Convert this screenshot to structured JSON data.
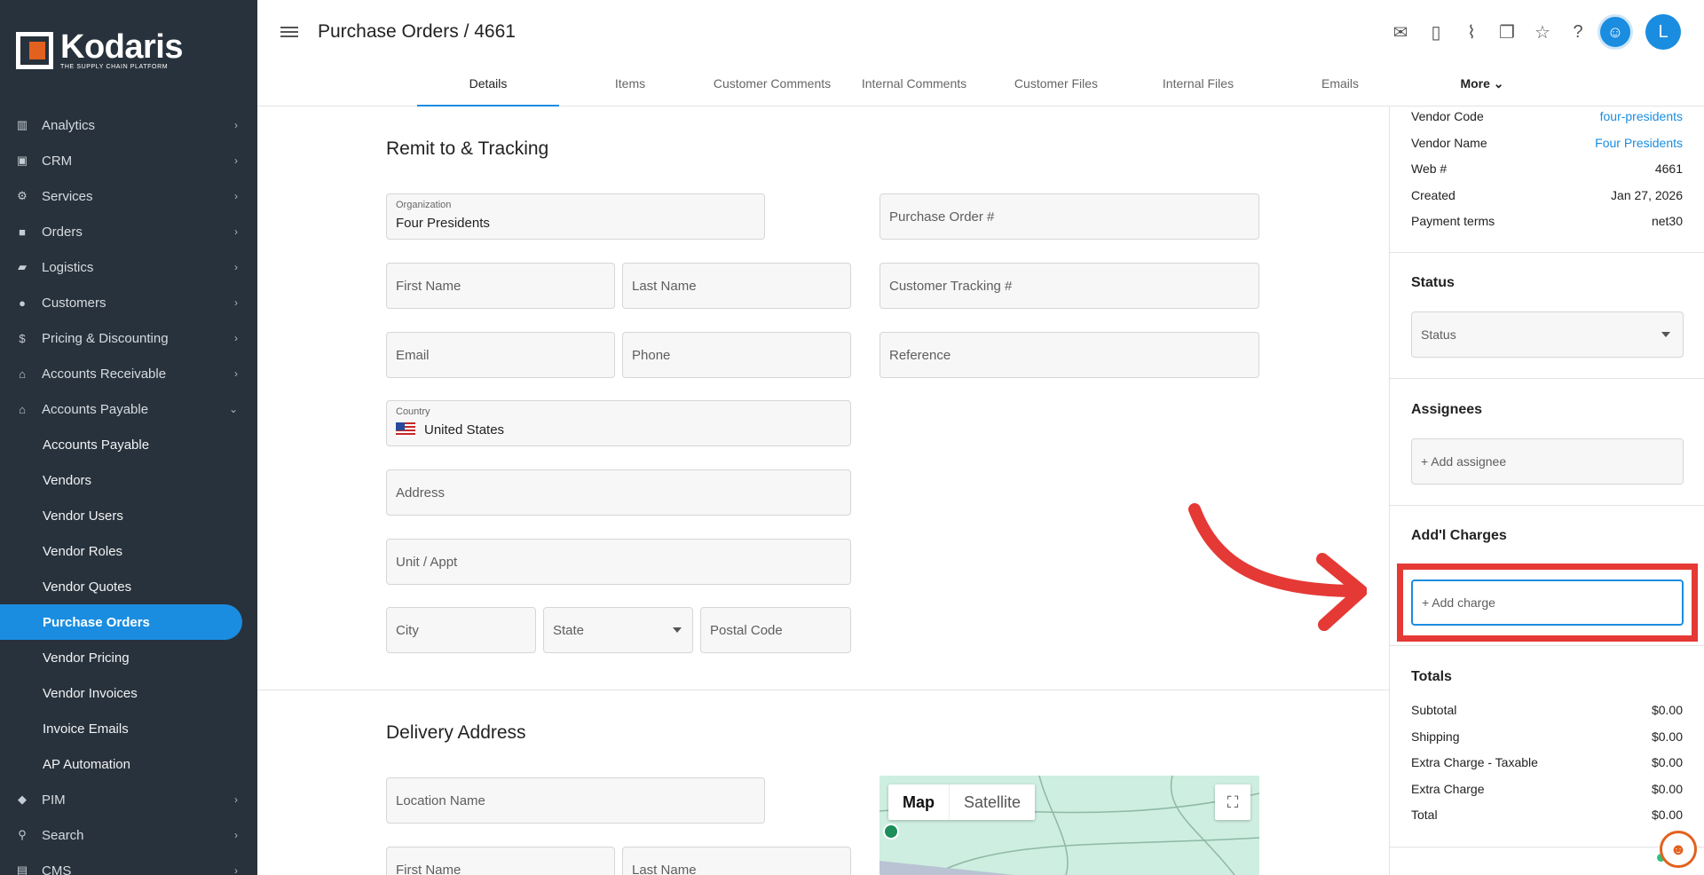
{
  "app": {
    "brand_name": "Kodaris",
    "brand_tagline": "THE SUPPLY CHAIN PLATFORM",
    "accent_color": "#1a8de0",
    "sidebar_color": "#28323c",
    "highlight_color": "#e53935"
  },
  "sidebar": {
    "items": [
      {
        "label": "Analytics",
        "icon": "chart-icon"
      },
      {
        "label": "CRM",
        "icon": "contact-card-icon"
      },
      {
        "label": "Services",
        "icon": "gears-icon"
      },
      {
        "label": "Orders",
        "icon": "truck-icon"
      },
      {
        "label": "Logistics",
        "icon": "delivery-truck-icon"
      },
      {
        "label": "Customers",
        "icon": "people-icon"
      },
      {
        "label": "Pricing & Discounting",
        "icon": "dollar-icon"
      },
      {
        "label": "Accounts Receivable",
        "icon": "bank-icon"
      },
      {
        "label": "Accounts Payable",
        "icon": "bank-icon"
      }
    ],
    "sub_items": [
      "Accounts Payable",
      "Vendors",
      "Vendor Users",
      "Vendor Roles",
      "Vendor Quotes",
      "Purchase Orders",
      "Vendor Pricing",
      "Vendor Invoices",
      "Invoice Emails",
      "AP Automation"
    ],
    "active_sub_item": "Purchase Orders",
    "bottom_items": [
      {
        "label": "PIM",
        "icon": "tag-icon"
      },
      {
        "label": "Search",
        "icon": "search-icon"
      },
      {
        "label": "CMS",
        "icon": "cms-icon"
      }
    ]
  },
  "header": {
    "title": "Purchase Orders / 4661",
    "avatar_initial": "L",
    "tabs": [
      "Details",
      "Items",
      "Customer Comments",
      "Internal Comments",
      "Customer Files",
      "Internal Files",
      "Emails"
    ],
    "active_tab": "Details",
    "more_label": "More"
  },
  "remit": {
    "title": "Remit to & Tracking",
    "organization_label": "Organization",
    "organization_value": "Four Presidents",
    "purchase_order_placeholder": "Purchase Order #",
    "first_name_placeholder": "First Name",
    "last_name_placeholder": "Last Name",
    "customer_tracking_placeholder": "Customer Tracking #",
    "email_placeholder": "Email",
    "phone_placeholder": "Phone",
    "reference_placeholder": "Reference",
    "country_label": "Country",
    "country_value": "United States",
    "address_placeholder": "Address",
    "unit_placeholder": "Unit / Appt",
    "city_placeholder": "City",
    "state_placeholder": "State",
    "postal_placeholder": "Postal Code"
  },
  "delivery": {
    "title": "Delivery Address",
    "location_placeholder": "Location Name",
    "first_name_placeholder": "First Name",
    "last_name_placeholder": "Last Name",
    "map_label": "Map",
    "satellite_label": "Satellite"
  },
  "info": {
    "rows": [
      {
        "key": "Vendor Code",
        "value": "four-presidents",
        "link": true
      },
      {
        "key": "Vendor Name",
        "value": "Four Presidents",
        "link": true
      },
      {
        "key": "Web #",
        "value": "4661",
        "link": false
      },
      {
        "key": "Created",
        "value": "Jan 27, 2026",
        "link": false
      },
      {
        "key": "Payment terms",
        "value": "net30",
        "link": false
      }
    ]
  },
  "status": {
    "title": "Status",
    "placeholder": "Status"
  },
  "assignees": {
    "title": "Assignees",
    "add_label": "+ Add assignee"
  },
  "charges": {
    "title": "Add'l Charges",
    "add_label": "+ Add charge"
  },
  "totals": {
    "title": "Totals",
    "rows": [
      {
        "key": "Subtotal",
        "value": "$0.00"
      },
      {
        "key": "Shipping",
        "value": "$0.00"
      },
      {
        "key": "Extra Charge - Taxable",
        "value": "$0.00"
      },
      {
        "key": "Extra Charge",
        "value": "$0.00"
      },
      {
        "key": "Total",
        "value": "$0.00"
      }
    ]
  }
}
